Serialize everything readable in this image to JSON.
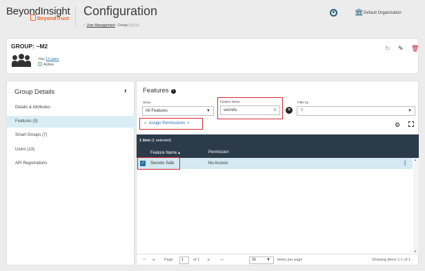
{
  "header": {
    "brand": "BeyondInsight",
    "brand_sub": "BeyondTrust",
    "title": "Configuration",
    "breadcrumb": {
      "link": "User Management",
      "sep": "›",
      "current": "Group"
    },
    "org": "Default Organization"
  },
  "group": {
    "title": "GROUP: ~M2",
    "has_prefix": "Has",
    "users_link": "13 users",
    "status": "Active"
  },
  "left": {
    "title": "Group Details",
    "items": [
      {
        "label": "Details & Attributes"
      },
      {
        "label": "Features (3)"
      },
      {
        "label": "Smart Groups (7)"
      },
      {
        "label": "Users (13)"
      },
      {
        "label": "API Registrations"
      }
    ]
  },
  "features": {
    "title": "Features",
    "show_label": "Show",
    "show_value": "All Features",
    "feature_name_label": "Feature Name",
    "feature_name_value": "secrets",
    "filter_label": "Filter by",
    "assign_label": "Assign Permissions",
    "count_bold": "1 item",
    "count_rest": "(1 selected)",
    "col_name": "Feature Name",
    "col_perm": "Permission",
    "rows": [
      {
        "name": "Secrets Safe",
        "permission": "No Access"
      }
    ],
    "pager": {
      "page_label": "Page",
      "page_value": "1",
      "of": "of 1",
      "per_page": "25",
      "per_page_label": "items per page",
      "showing": "Showing items 1-1 of 1"
    }
  }
}
